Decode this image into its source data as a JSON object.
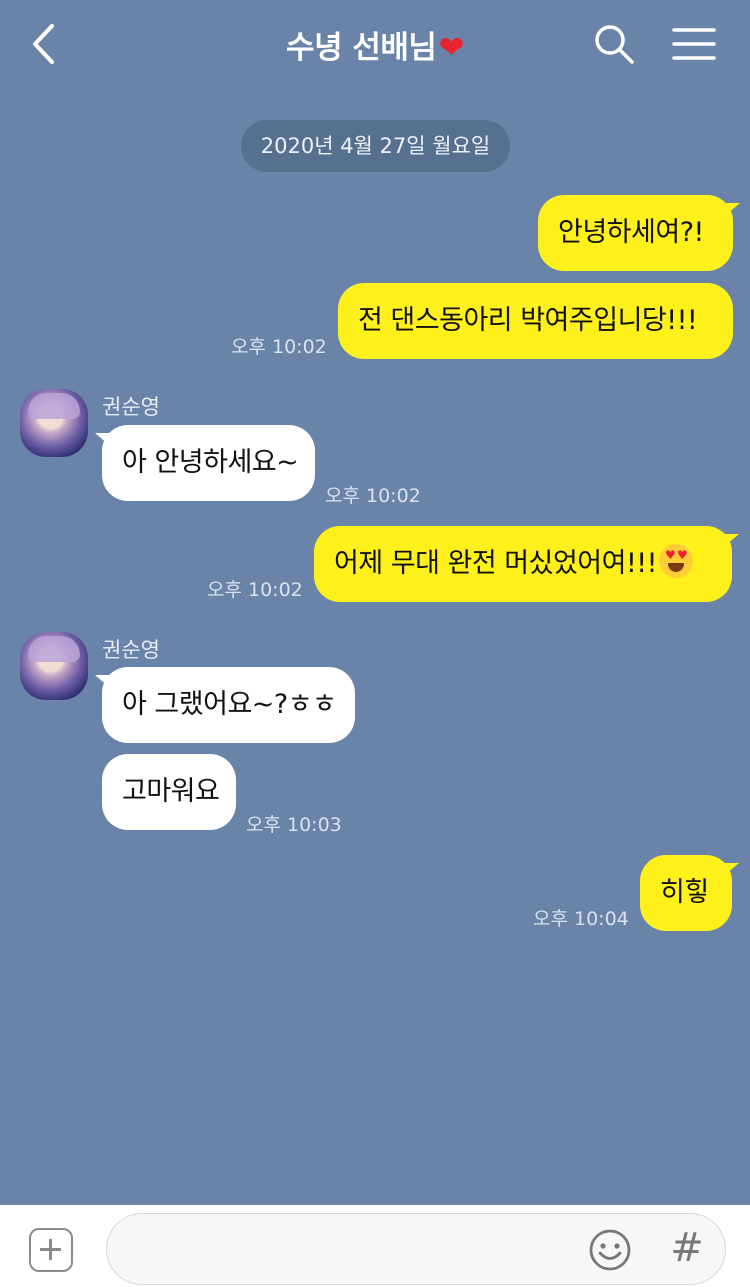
{
  "header": {
    "title": "수녕 선배님",
    "title_emoji": "❤",
    "back_icon": "chevron-left-icon",
    "search_icon": "search-icon",
    "menu_icon": "hamburger-menu-icon"
  },
  "date_divider": "2020년 4월 27일 월요일",
  "messages": [
    {
      "from": "me",
      "text": "안녕하세여?!"
    },
    {
      "from": "me",
      "text": "전 댄스동아리 박여주입니당!!!",
      "time": "오후 10:02"
    },
    {
      "from": "other",
      "sender": "권순영",
      "text": "아 안녕하세요~",
      "time": "오후 10:02"
    },
    {
      "from": "me",
      "text": "어제 무대 완전 머싰었어여!!!",
      "emoji": "heart-eyes-emoji",
      "time": "오후 10:02"
    },
    {
      "from": "other",
      "sender": "권순영",
      "text": "아 그랬어요~?ㅎㅎ"
    },
    {
      "from": "other",
      "text": "고마워요",
      "time": "오후 10:03"
    },
    {
      "from": "me",
      "text": "히힣",
      "time": "오후 10:04"
    }
  ],
  "composer": {
    "placeholder": "",
    "value": "",
    "plus_icon": "plus-icon",
    "emoji_icon": "smiley-icon",
    "hash_label": "#"
  },
  "colors": {
    "background": "#6a84a9",
    "my_bubble": "#fef01b",
    "their_bubble": "#ffffff",
    "date_pill": "#56708f"
  }
}
